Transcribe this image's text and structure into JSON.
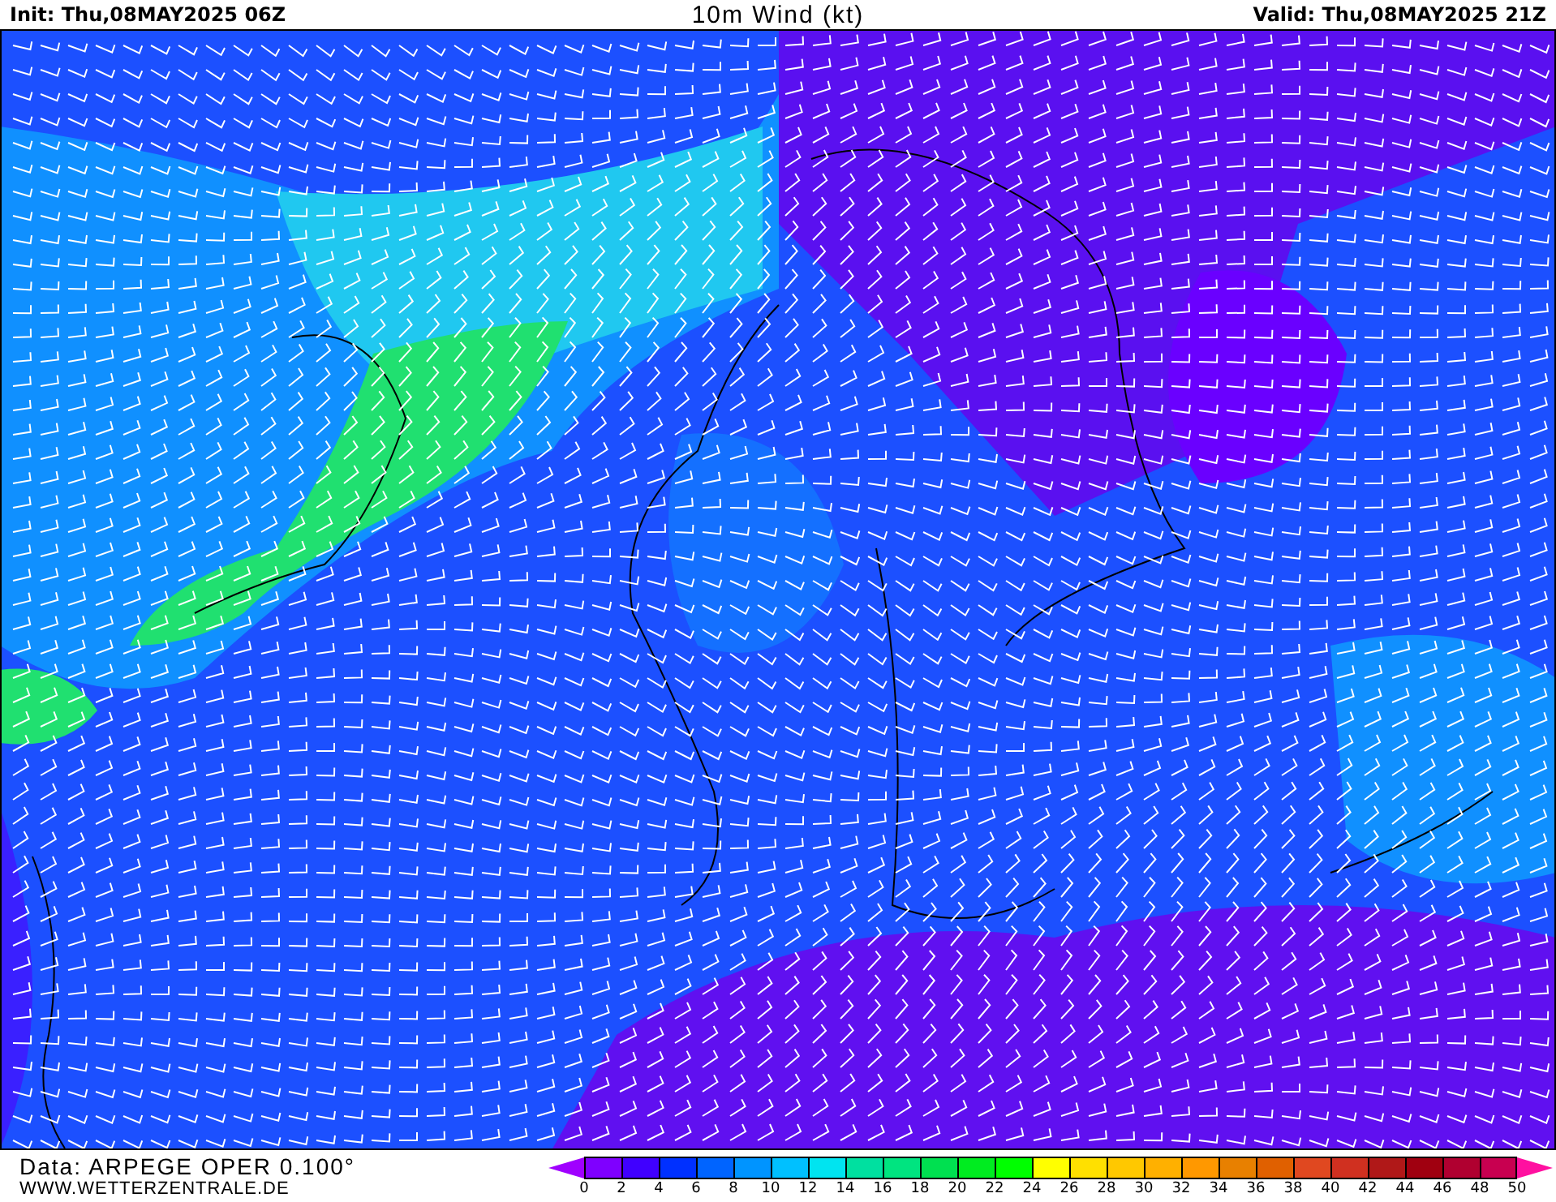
{
  "header": {
    "init": "Init: Thu,08MAY2025 06Z",
    "title": "10m Wind (kt)",
    "valid": "Valid: Thu,08MAY2025 21Z"
  },
  "footer": {
    "data_source": "Data: ARPEGE OPER 0.100°",
    "website": "WWW.WETTERZENTRALE.DE"
  },
  "legend": {
    "bins": [
      {
        "kind": "under",
        "color": "#a000ff"
      },
      {
        "kind": "bin",
        "color": "#7f00ff"
      },
      {
        "kind": "bin",
        "color": "#4000ff"
      },
      {
        "kind": "bin",
        "color": "#0030ff"
      },
      {
        "kind": "bin",
        "color": "#0064ff"
      },
      {
        "kind": "bin",
        "color": "#0094ff"
      },
      {
        "kind": "bin",
        "color": "#00c0ff"
      },
      {
        "kind": "bin",
        "color": "#00e4f0"
      },
      {
        "kind": "bin",
        "color": "#00e0a0"
      },
      {
        "kind": "bin",
        "color": "#00e480"
      },
      {
        "kind": "bin",
        "color": "#00e050"
      },
      {
        "kind": "bin",
        "color": "#00ec20"
      },
      {
        "kind": "bin",
        "color": "#00ff00"
      },
      {
        "kind": "bin",
        "color": "#ffff00"
      },
      {
        "kind": "bin",
        "color": "#ffe000"
      },
      {
        "kind": "bin",
        "color": "#ffc800"
      },
      {
        "kind": "bin",
        "color": "#ffb000"
      },
      {
        "kind": "bin",
        "color": "#ff9800"
      },
      {
        "kind": "bin",
        "color": "#e88000"
      },
      {
        "kind": "bin",
        "color": "#e06000"
      },
      {
        "kind": "bin",
        "color": "#e04820"
      },
      {
        "kind": "bin",
        "color": "#d03020"
      },
      {
        "kind": "bin",
        "color": "#b01818"
      },
      {
        "kind": "bin",
        "color": "#a00010"
      },
      {
        "kind": "bin",
        "color": "#b00030"
      },
      {
        "kind": "bin",
        "color": "#c80050"
      },
      {
        "kind": "over",
        "color": "#ff10a0"
      }
    ],
    "ticks": [
      "0",
      "2",
      "4",
      "6",
      "8",
      "10",
      "12",
      "14",
      "16",
      "18",
      "20",
      "22",
      "24",
      "26",
      "28",
      "30",
      "32",
      "34",
      "36",
      "38",
      "40",
      "42",
      "44",
      "46",
      "48",
      "50"
    ]
  }
}
